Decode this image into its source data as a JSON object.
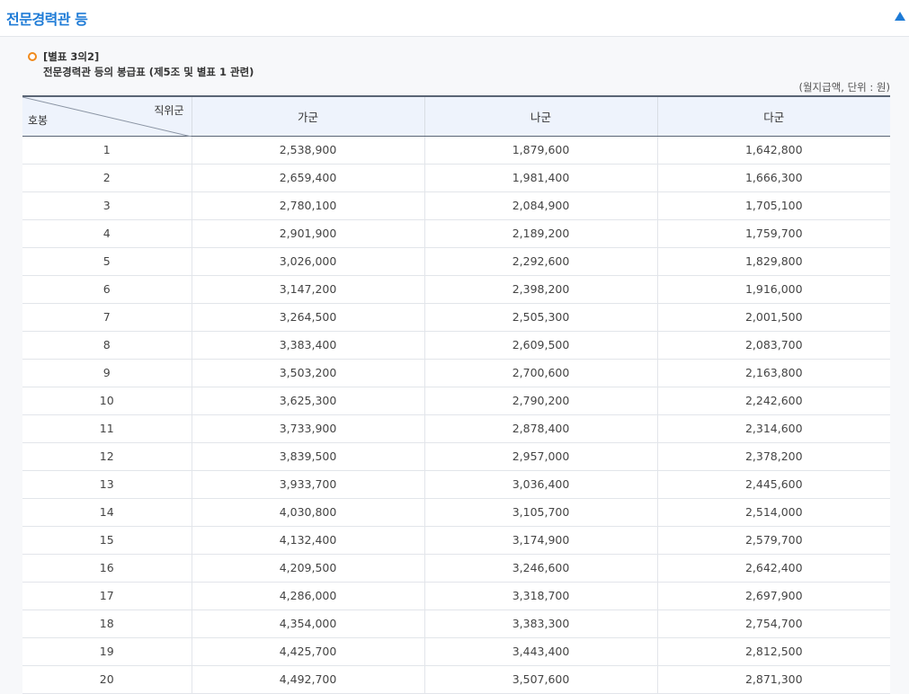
{
  "section": {
    "title": "전문경력관 등",
    "collapse_icon": "triangle-up-icon",
    "accent_color": "#1e7bd6"
  },
  "note": {
    "line1": "[별표 3의2]",
    "line2": "전문경력관 등의 봉급표 (제5조 및 별표 1 관련)",
    "bullet_color": "#f08a1c"
  },
  "unit_note": "(월지급액, 단위 : 원)",
  "table": {
    "corner_top": "직위군",
    "corner_bottom": "호봉",
    "columns": [
      "가군",
      "나군",
      "다군"
    ],
    "rows": [
      [
        "1",
        "2,538,900",
        "1,879,600",
        "1,642,800"
      ],
      [
        "2",
        "2,659,400",
        "1,981,400",
        "1,666,300"
      ],
      [
        "3",
        "2,780,100",
        "2,084,900",
        "1,705,100"
      ],
      [
        "4",
        "2,901,900",
        "2,189,200",
        "1,759,700"
      ],
      [
        "5",
        "3,026,000",
        "2,292,600",
        "1,829,800"
      ],
      [
        "6",
        "3,147,200",
        "2,398,200",
        "1,916,000"
      ],
      [
        "7",
        "3,264,500",
        "2,505,300",
        "2,001,500"
      ],
      [
        "8",
        "3,383,400",
        "2,609,500",
        "2,083,700"
      ],
      [
        "9",
        "3,503,200",
        "2,700,600",
        "2,163,800"
      ],
      [
        "10",
        "3,625,300",
        "2,790,200",
        "2,242,600"
      ],
      [
        "11",
        "3,733,900",
        "2,878,400",
        "2,314,600"
      ],
      [
        "12",
        "3,839,500",
        "2,957,000",
        "2,378,200"
      ],
      [
        "13",
        "3,933,700",
        "3,036,400",
        "2,445,600"
      ],
      [
        "14",
        "4,030,800",
        "3,105,700",
        "2,514,000"
      ],
      [
        "15",
        "4,132,400",
        "3,174,900",
        "2,579,700"
      ],
      [
        "16",
        "4,209,500",
        "3,246,600",
        "2,642,400"
      ],
      [
        "17",
        "4,286,000",
        "3,318,700",
        "2,697,900"
      ],
      [
        "18",
        "4,354,000",
        "3,383,300",
        "2,754,700"
      ],
      [
        "19",
        "4,425,700",
        "3,443,400",
        "2,812,500"
      ],
      [
        "20",
        "4,492,700",
        "3,507,600",
        "2,871,300"
      ]
    ]
  }
}
